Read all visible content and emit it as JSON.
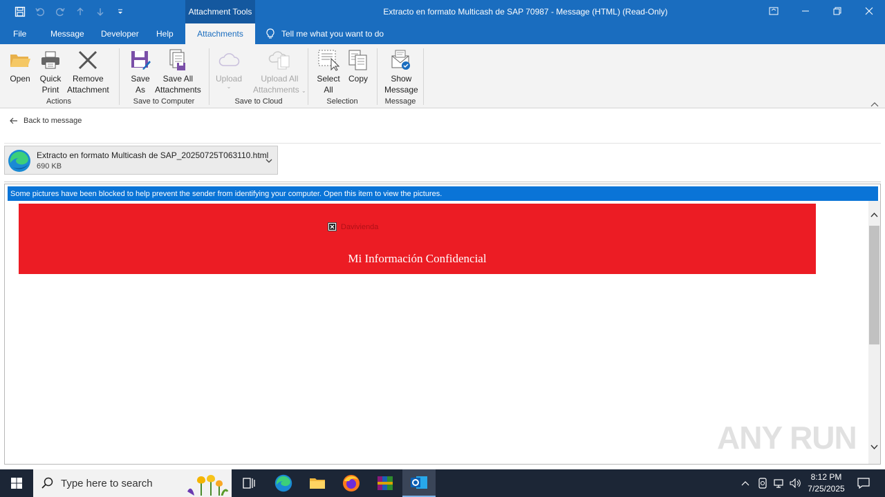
{
  "window": {
    "title": "Extracto en formato Multicash de SAP 70987  -  Message (HTML) (Read-Only)",
    "context_tab_group": "Attachment Tools"
  },
  "tabs": {
    "file": "File",
    "message": "Message",
    "developer": "Developer",
    "help": "Help",
    "attachments": "Attachments",
    "tell_me": "Tell me what you want to do"
  },
  "ribbon": {
    "open": "Open",
    "quick_print_1": "Quick",
    "quick_print_2": "Print",
    "remove_1": "Remove",
    "remove_2": "Attachment",
    "group_actions": "Actions",
    "save_as_1": "Save",
    "save_as_2": "As",
    "save_all_1": "Save All",
    "save_all_2": "Attachments",
    "group_save_computer": "Save to Computer",
    "upload": "Upload",
    "upload_all_1": "Upload All",
    "upload_all_2": "Attachments",
    "group_save_cloud": "Save to Cloud",
    "select_all_1": "Select",
    "select_all_2": "All",
    "copy": "Copy",
    "group_selection": "Selection",
    "show_message_1": "Show",
    "show_message_2": "Message",
    "group_message": "Message"
  },
  "reading": {
    "back": "Back to message",
    "attachment_name": "Extracto en formato Multicash de SAP_20250725T063110.html",
    "attachment_size": "690 KB",
    "infobar": "Some pictures have been blocked to help prevent the sender from identifying your computer. Open this item to view the pictures.",
    "broken_image_alt": "Davivienda",
    "banner_title": "Mi Información Confidencial",
    "banner_color": "#ec1c24",
    "watermark": "ANY RUN"
  },
  "taskbar": {
    "search_placeholder": "Type here to search",
    "time": "8:12 PM",
    "date": "7/25/2025"
  },
  "colors": {
    "titlebar": "#1a6dbf",
    "ribbon": "#f3f3f3",
    "infobar": "#0a74d7",
    "taskbar": "#1c2636"
  }
}
